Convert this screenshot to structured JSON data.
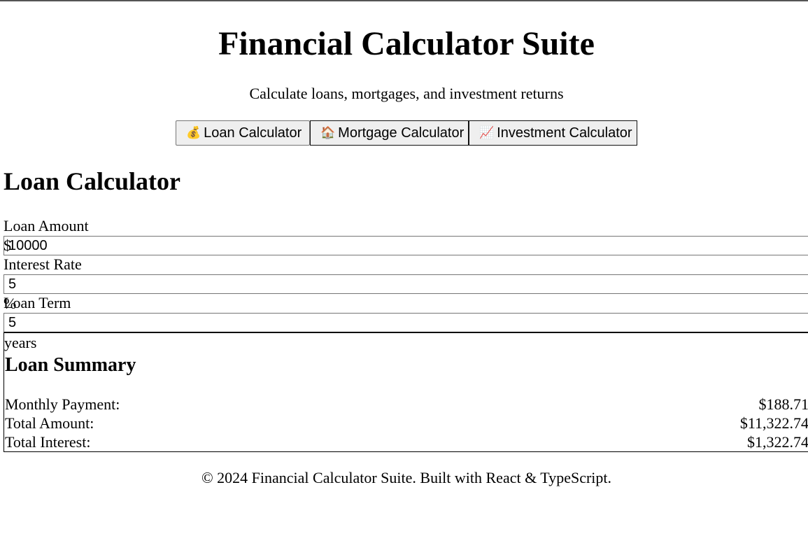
{
  "header": {
    "title": "Financial Calculator Suite",
    "subtitle": "Calculate loans, mortgages, and investment returns"
  },
  "tabs": [
    {
      "icon": "money-bag-icon",
      "glyph": "💰",
      "label": "Loan Calculator",
      "active": true
    },
    {
      "icon": "house-icon",
      "glyph": "🏠",
      "label": "Mortgage Calculator",
      "active": false
    },
    {
      "icon": "chart-increasing-icon",
      "glyph": "📈",
      "label": "Investment Calculator",
      "active": false
    }
  ],
  "loan": {
    "section_title": "Loan Calculator",
    "amount": {
      "label": "Loan Amount",
      "prefix": "$",
      "value": "10000"
    },
    "rate": {
      "label": "Interest Rate",
      "value": "5",
      "suffix": "%"
    },
    "term": {
      "label": "Loan Term",
      "value": "5",
      "suffix": "years"
    }
  },
  "summary": {
    "title": "Loan Summary",
    "rows": [
      {
        "label": "Monthly Payment:",
        "value": "$188.71"
      },
      {
        "label": "Total Amount:",
        "value": "$11,322.74"
      },
      {
        "label": "Total Interest:",
        "value": "$1,322.74"
      }
    ]
  },
  "footer": {
    "text": "© 2024 Financial Calculator Suite. Built with React & TypeScript."
  }
}
